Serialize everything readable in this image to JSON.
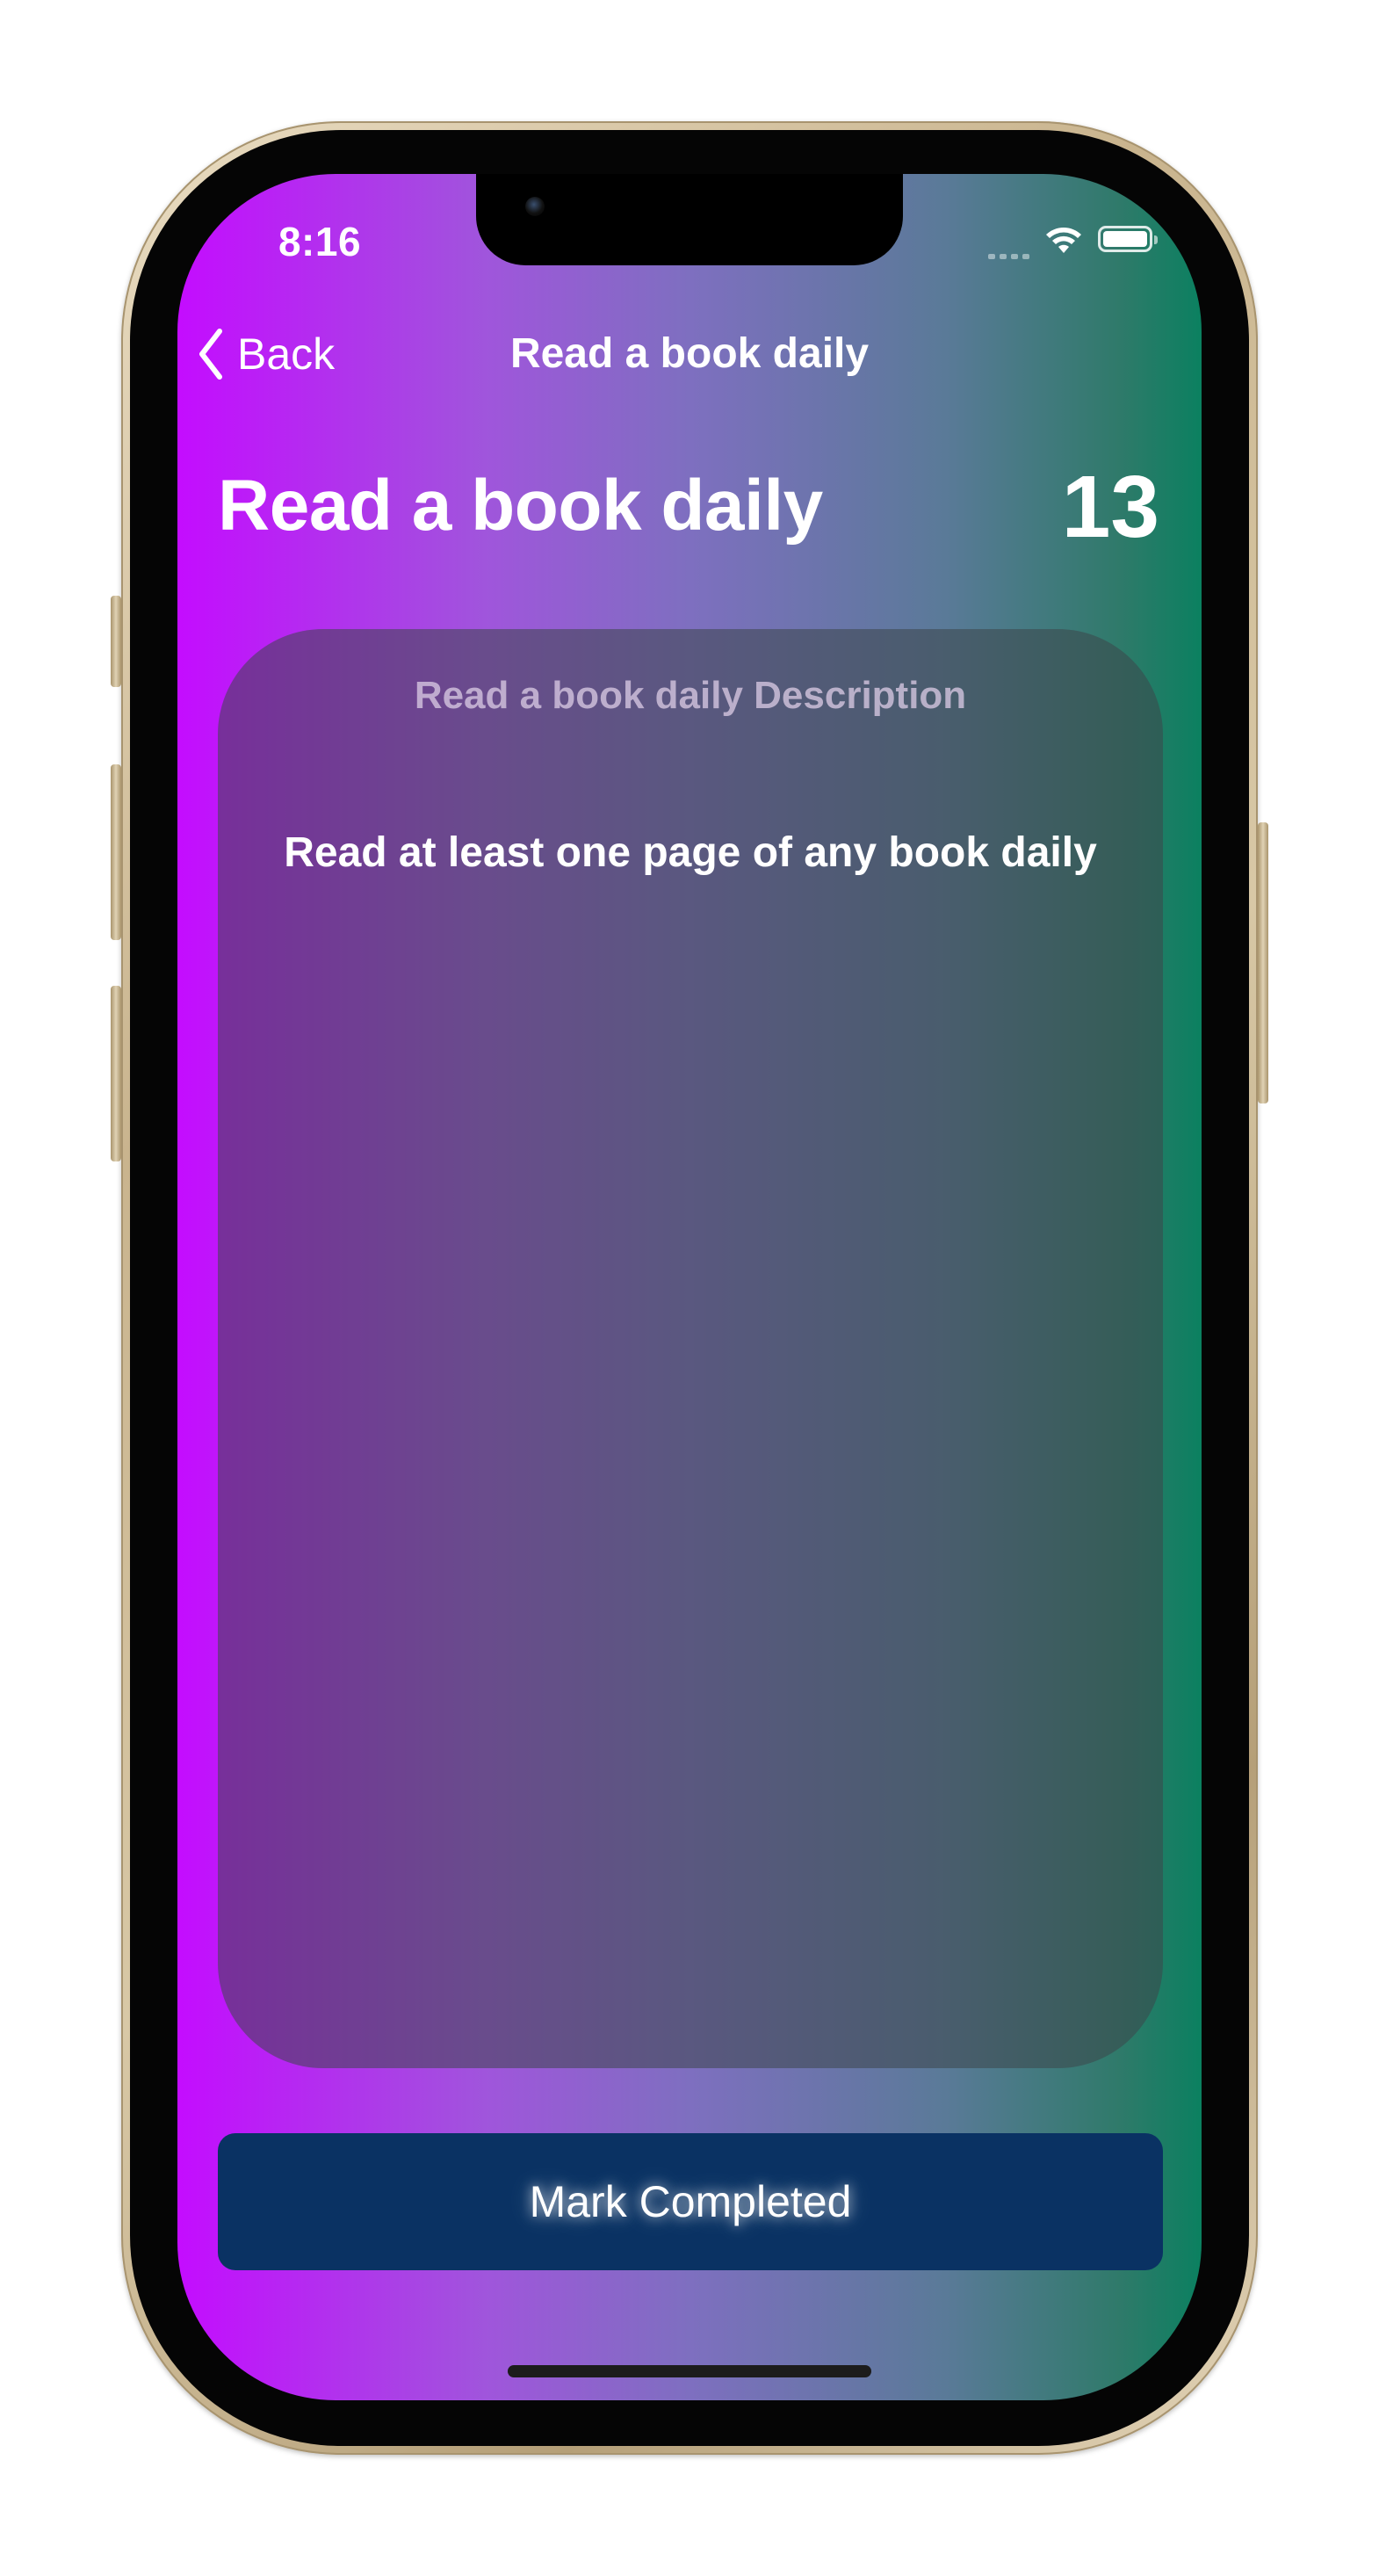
{
  "status_bar": {
    "time": "8:16",
    "icons": [
      "signal-icon",
      "wifi-icon",
      "battery-icon"
    ]
  },
  "nav": {
    "back_label": "Back",
    "back_icon": "chevron-left-icon",
    "title": "Read a book daily"
  },
  "habit": {
    "title": "Read a book daily",
    "count": "13"
  },
  "card": {
    "heading": "Read a book daily Description",
    "body": "Read at least one page of any book daily"
  },
  "action": {
    "mark_completed_label": "Mark Completed"
  },
  "colors": {
    "gradient_start": "#c40cff",
    "gradient_mid": "#7e6fc0",
    "gradient_end": "#0b8060",
    "button_bg": "#0a3263",
    "frame_gold": "#c9b48e"
  }
}
